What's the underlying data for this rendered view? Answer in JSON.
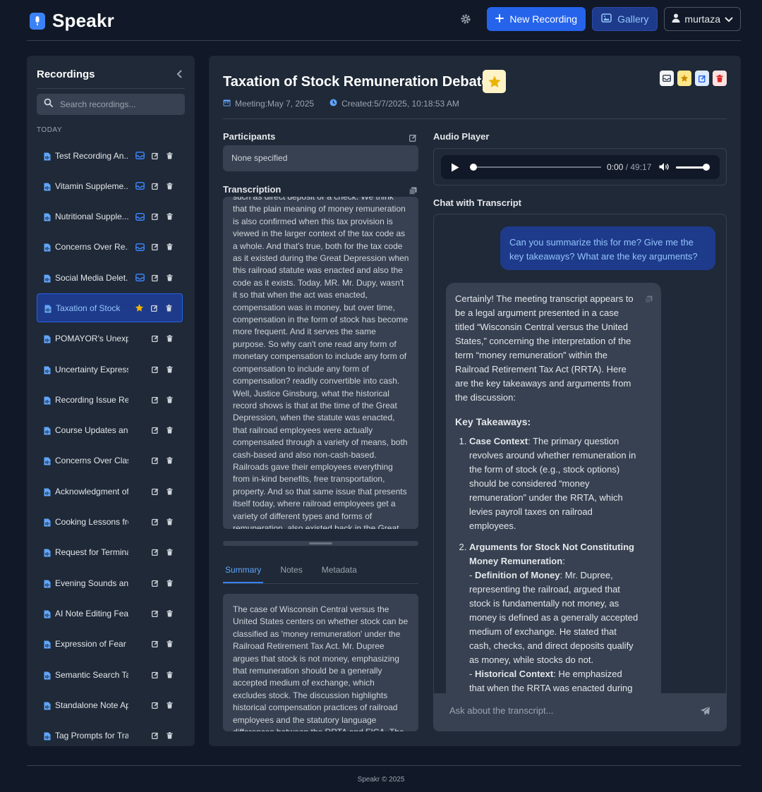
{
  "app": {
    "name": "Speakr"
  },
  "header": {
    "new_recording": "New Recording",
    "gallery": "Gallery",
    "user": "murtaza"
  },
  "sidebar": {
    "title": "Recordings",
    "search_placeholder": "Search recordings...",
    "group_label": "TODAY",
    "items": [
      {
        "label": "Test Recording An...",
        "inbox": true
      },
      {
        "label": "Vitamin Suppleme...",
        "inbox": true
      },
      {
        "label": "Nutritional Supple...",
        "inbox": true
      },
      {
        "label": "Concerns Over Re...",
        "inbox": true
      },
      {
        "label": "Social Media Delet...",
        "inbox": true
      },
      {
        "label": "Taxation of Stock ...",
        "starred": true,
        "active": true
      },
      {
        "label": "POMAYOR's Unexpect..."
      },
      {
        "label": "Uncertainty Expressed..."
      },
      {
        "label": "Recording Issue Resol..."
      },
      {
        "label": "Course Updates and F..."
      },
      {
        "label": "Concerns Over Classm..."
      },
      {
        "label": "Acknowledgment of C..."
      },
      {
        "label": "Cooking Lessons from..."
      },
      {
        "label": "Request for Terminal E..."
      },
      {
        "label": "Evening Sounds and A..."
      },
      {
        "label": "AI Note Editing Featur..."
      },
      {
        "label": "Expression of Fear"
      },
      {
        "label": "Semantic Search Taggi..."
      },
      {
        "label": "Standalone Note App ..."
      },
      {
        "label": "Tag Prompts for Trans..."
      }
    ]
  },
  "recording": {
    "title": "Taxation of Stock Remuneration Debate",
    "meeting_label": "Meeting:",
    "meeting_date": "May 7, 2025",
    "created_label": "Created:",
    "created_value": "5/7/2025, 10:18:53 AM"
  },
  "participants": {
    "label": "Participants",
    "value": "None specified"
  },
  "transcription": {
    "label": "Transcription",
    "text": "such as direct deposit or a check. We think that the plain meaning of money remuneration is also confirmed when this tax provision is viewed in the larger context of the tax code as a whole. And that's true, both for the tax code as it existed during the Great Depression when this railroad statute was enacted and also the code as it exists. Today. MR. Mr. Dupy, wasn't it so that when the act was enacted, compensation was in money, but over time, compensation in the form of stock has become more frequent. And it serves the same purpose. So why can't one read any form of monetary compensation to include any form of compensation to include any form of compensation? readily convertible into cash. Well, Justice Ginsburg, what the historical record shows is that at the time of the Great Depression, when the statute was enacted, that railroad employees were actually compensated through a variety of means, both cash-based and also non-cash-based. Railroads gave their employees everything from in-kind benefits, free transportation, property. And so that same issue that presents itself today, where railroad employees get a variety of different types and forms of remuneration, also existed back in the Great Depression. And what Congress did was it said we are going to tax"
  },
  "tabs": [
    "Summary",
    "Notes",
    "Metadata"
  ],
  "summary": {
    "text": "The case of Wisconsin Central versus the United States centers on whether stock can be classified as 'money remuneration' under the Railroad Retirement Tax Act. Mr. Dupree argues that stock is not money, emphasizing that remuneration should be a generally accepted medium of exchange, which excludes stock. The discussion highlights historical compensation practices of railroad employees and the statutory language differences between the RRTA and FICA. The government contends that"
  },
  "audio": {
    "label": "Audio Player",
    "current": "0:00",
    "separator": " / ",
    "duration": "49:17"
  },
  "chat": {
    "label": "Chat with Transcript",
    "user_message": "Can you summarize this for me? Give me the key takeaways? What are the key arguments?",
    "assistant_intro": "Certainly! The meeting transcript appears to be a legal argument presented in a case titled “Wisconsin Central versus the United States,” concerning the interpretation of the term “money remuneration” within the Railroad Retirement Tax Act (RRTA). Here are the key takeaways and arguments from the discussion:",
    "key_heading": "Key Takeaways:",
    "points": [
      {
        "bold": "Case Context",
        "text": ": The primary question revolves around whether remuneration in the form of stock (e.g., stock options) should be considered “money remuneration” under the RRTA, which levies payroll taxes on railroad employees."
      },
      {
        "bold": "Arguments for Stock Not Constituting Money Remuneration",
        "text": ":"
      }
    ],
    "sub1_bold": "Definition of Money",
    "sub1_text": ": Mr. Dupree, representing the railroad, argued that stock is fundamentally not money, as money is defined as a generally accepted medium of exchange. He stated that cash, checks, and direct deposits qualify as money, while stocks do not.",
    "sub2_bold": "Historical Context",
    "sub2_text": ": He emphasized that when the RRTA was enacted during the Great Depression, railroad employees were compensated in a variety of ways.",
    "input_placeholder": "Ask about the transcript..."
  },
  "footer": {
    "text": "Speakr © 2025"
  },
  "colors": {
    "accent": "#2563eb",
    "star": "#eab308",
    "danger": "#dc2626"
  }
}
